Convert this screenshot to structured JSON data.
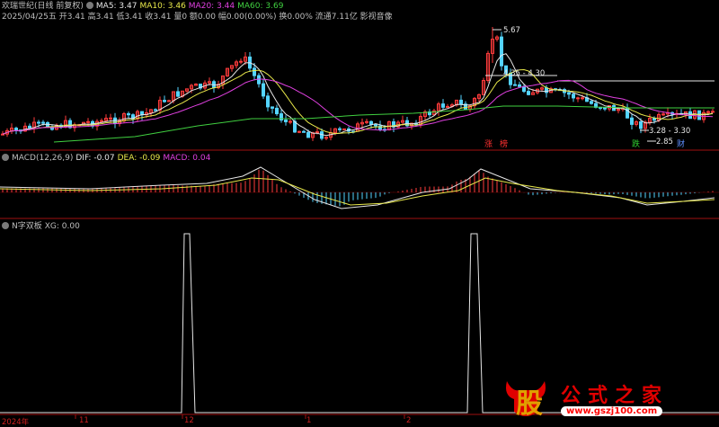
{
  "header": {
    "title": "欢瑞世纪(日线 前复权)",
    "ma": [
      {
        "label": "MA5: 3.47",
        "color": "#e6e6e6"
      },
      {
        "label": "MA10: 3.46",
        "color": "#e8e84a"
      },
      {
        "label": "MA20: 3.44",
        "color": "#e040e0"
      },
      {
        "label": "MA60: 3.69",
        "color": "#40d040"
      }
    ],
    "quote": "2025/04/25五 开3.41 高3.41 低3.41 收3.41 量0 额0.00 幅0.00(0.00%) 换0.00% 流通7.11亿 影视音像"
  },
  "price_annotations": {
    "high": "5.67",
    "range1": "4.35 - 4.30",
    "range2": "3.28 - 3.30",
    "low": "2.85"
  },
  "event_tags": [
    {
      "text": "涨",
      "color": "#ff3030"
    },
    {
      "text": "榜",
      "color": "#ff3030"
    },
    {
      "text": "跌",
      "color": "#30d030"
    },
    {
      "text": "财",
      "color": "#6090ff"
    }
  ],
  "macd_header": {
    "name": "MACD(12,26,9)",
    "dif": "DIF: -0.07",
    "dea": "DEA: -0.09",
    "macd": "MACD: 0.04"
  },
  "nx_header": {
    "name": "N字双板",
    "xg": "XG: 0.00"
  },
  "x_axis": {
    "year": "2024年",
    "months": [
      "11",
      "12",
      "1",
      "2"
    ]
  },
  "watermark": {
    "char": "股",
    "name": "公式之家",
    "url": "www.gszj100.com"
  },
  "colors": {
    "up": "#ff3b3b",
    "down": "#54d4ff",
    "ma5": "#e6e6e6",
    "ma10": "#e8e84a",
    "ma20": "#e040e0",
    "ma60": "#40d040",
    "separator": "#a01010"
  },
  "chart_data": [
    {
      "type": "candlestick",
      "title": "欢瑞世纪(日线 前复权)",
      "series": [
        {
          "name": "MA5",
          "last": 3.47
        },
        {
          "name": "MA10",
          "last": 3.46
        },
        {
          "name": "MA20",
          "last": 3.44
        },
        {
          "name": "MA60",
          "last": 3.69
        }
      ],
      "annotated_prices": [
        5.67,
        4.35,
        4.3,
        3.28,
        3.3,
        2.85
      ]
    },
    {
      "type": "line",
      "title": "MACD(12,26,9)",
      "series": [
        {
          "name": "DIF",
          "last": -0.07
        },
        {
          "name": "DEA",
          "last": -0.09
        },
        {
          "name": "MACD",
          "last": 0.04
        }
      ]
    },
    {
      "type": "line",
      "title": "N字双板",
      "series": [
        {
          "name": "XG",
          "last": 0.0
        }
      ],
      "ylim": [
        0,
        1
      ]
    }
  ]
}
